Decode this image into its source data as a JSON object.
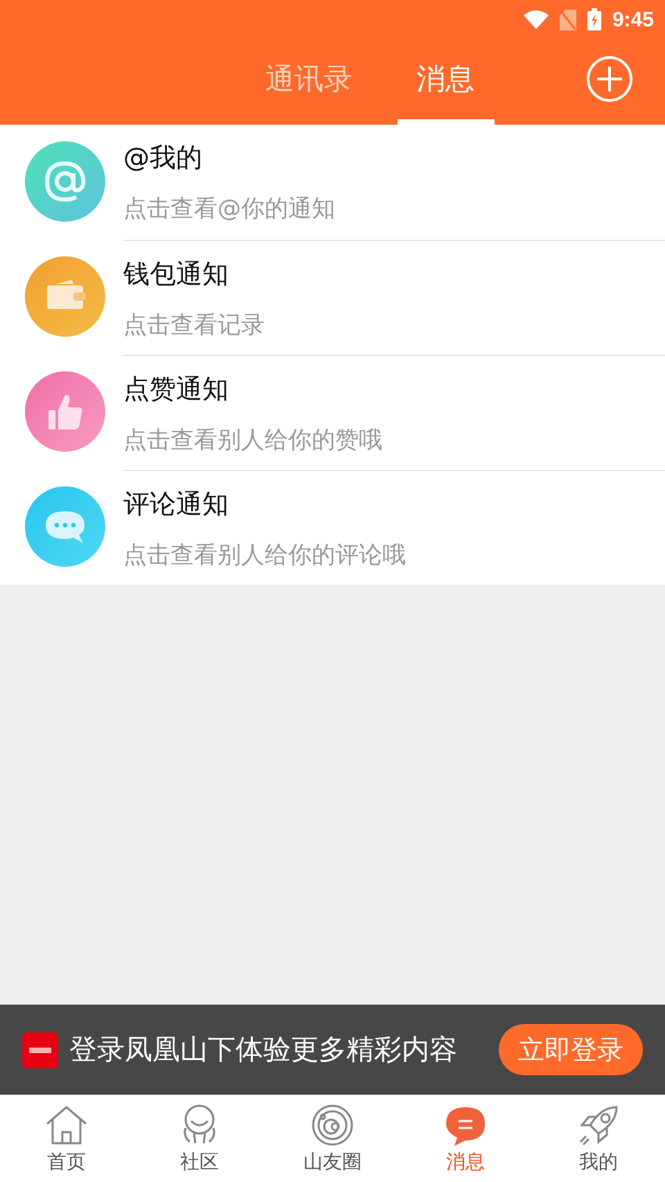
{
  "status_bar": {
    "time": "9:45"
  },
  "header": {
    "tabs": [
      {
        "label": "通讯录",
        "selected": false
      },
      {
        "label": "消息",
        "selected": true
      }
    ]
  },
  "items": [
    {
      "kind": "mention",
      "title": "@我的",
      "subtitle": "点击查看@你的通知"
    },
    {
      "kind": "wallet",
      "title": "钱包通知",
      "subtitle": "点击查看记录"
    },
    {
      "kind": "like",
      "title": "点赞通知",
      "subtitle": "点击查看别人给你的赞哦"
    },
    {
      "kind": "comment",
      "title": "评论通知",
      "subtitle": "点击查看别人给你的评论哦"
    }
  ],
  "login_banner": {
    "text": "登录凤凰山下体验更多精彩内容",
    "button": "立即登录"
  },
  "bottom_nav": [
    {
      "kind": "home",
      "label": "首页",
      "selected": false
    },
    {
      "kind": "community",
      "label": "社区",
      "selected": false
    },
    {
      "kind": "circle",
      "label": "山友圈",
      "selected": false
    },
    {
      "kind": "message",
      "label": "消息",
      "selected": true
    },
    {
      "kind": "me",
      "label": "我的",
      "selected": false
    }
  ]
}
